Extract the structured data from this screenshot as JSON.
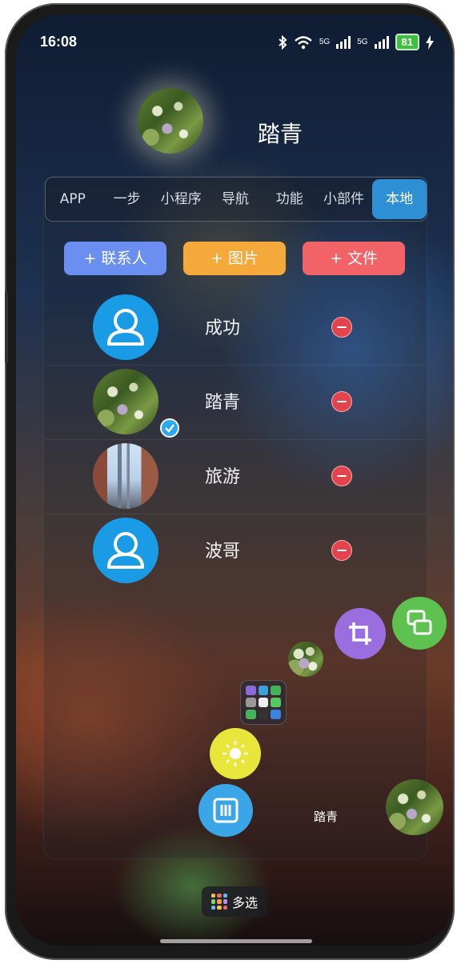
{
  "status_bar": {
    "time": "16:08",
    "signal_1": "5G",
    "signal_2": "5G",
    "battery": "81"
  },
  "header": {
    "title": "踏青"
  },
  "tabs": [
    {
      "label": "APP",
      "active": false
    },
    {
      "label": "一步",
      "active": false
    },
    {
      "label": "小程序",
      "active": false
    },
    {
      "label": "导航",
      "active": false
    },
    {
      "label": "功能",
      "active": false
    },
    {
      "label": "小部件",
      "active": false
    },
    {
      "label": "本地",
      "active": true
    }
  ],
  "actions": {
    "add_contact": "+ 联系人",
    "add_image": "+ 图片",
    "add_file": "+ 文件"
  },
  "items": [
    {
      "name": "成功",
      "avatar": "contact-icon"
    },
    {
      "name": "踏青",
      "avatar": "photo",
      "selected": true
    },
    {
      "name": "旅游",
      "avatar": "photo"
    },
    {
      "name": "波哥",
      "avatar": "contact-icon"
    }
  ],
  "floating": {
    "label": "踏青"
  },
  "bottom": {
    "multiselect": "多选"
  },
  "colors": {
    "tab_active": "#2f8fd4",
    "contact_button": "#6b8ff0",
    "image_button": "#f6a93b",
    "file_button": "#f26368",
    "remove": "#e3434c",
    "check": "#2aa8f0"
  }
}
